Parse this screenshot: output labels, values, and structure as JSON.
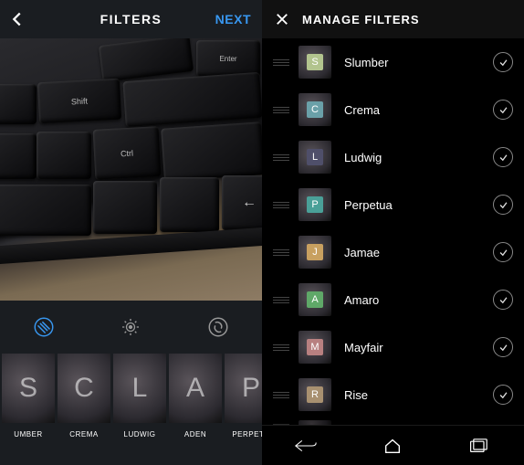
{
  "left": {
    "title": "FILTERS",
    "next": "NEXT",
    "photo_keys": [
      "Enter",
      "Shift",
      "Ctrl"
    ],
    "filters": [
      {
        "letter": "S",
        "label": "UMBER"
      },
      {
        "letter": "C",
        "label": "CREMA"
      },
      {
        "letter": "L",
        "label": "LUDWIG"
      },
      {
        "letter": "A",
        "label": "ADEN"
      },
      {
        "letter": "P",
        "label": "PERPETU"
      }
    ]
  },
  "right": {
    "title": "MANAGE FILTERS",
    "items": [
      {
        "letter": "S",
        "name": "Slumber",
        "color": "#b2c48e"
      },
      {
        "letter": "C",
        "name": "Crema",
        "color": "#6aa0a8"
      },
      {
        "letter": "L",
        "name": "Ludwig",
        "color": "#4f4f6a"
      },
      {
        "letter": "P",
        "name": "Perpetua",
        "color": "#4aa098"
      },
      {
        "letter": "J",
        "name": "Jamae",
        "color": "#c8a060"
      },
      {
        "letter": "A",
        "name": "Amaro",
        "color": "#5fa868"
      },
      {
        "letter": "M",
        "name": "Mayfair",
        "color": "#b88080"
      },
      {
        "letter": "R",
        "name": "Rise",
        "color": "#a89070"
      }
    ]
  }
}
